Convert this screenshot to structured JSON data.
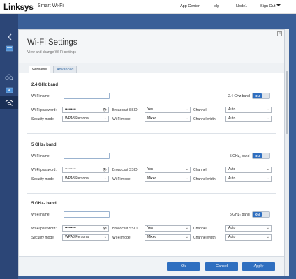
{
  "app": {
    "logo": "Linksys",
    "product": "Smart Wi-Fi",
    "nav": [
      "App Center",
      "Help",
      "Node1",
      "Sign Out"
    ]
  },
  "sidebar": {
    "back_icon": "chevron-left-icon",
    "items": [
      "device-list-icon",
      "connectivity-icon",
      "network-map-icon",
      "wifi-settings-icon"
    ]
  },
  "modal": {
    "title": "Wi-Fi Settings",
    "subtitle": "View and change Wi-Fi settings",
    "close_label": "x",
    "tabs": [
      "Wireless",
      "Advanced"
    ]
  },
  "labels": {
    "wifi_name": "Wi-Fi name:",
    "wifi_password": "Wi-Fi password:",
    "security_mode": "Security mode:",
    "broadcast_ssid": "Broadcast SSID:",
    "wifi_mode": "Wi-Fi mode:",
    "channel": "Channel:",
    "channel_width": "Channel width:"
  },
  "bands": [
    {
      "title": "2.4 GHz band",
      "toggle_label": "2.4 GHz band",
      "toggle_state": "ON",
      "wifi_name": "",
      "password": "•••••••••",
      "security_mode": "WPA3 Personal",
      "broadcast_ssid": "Yes",
      "wifi_mode": "Mixed",
      "channel": "Auto",
      "channel_width": "Auto"
    },
    {
      "title": "5 GHz₁ band",
      "toggle_label": "5 GHz₁ band",
      "toggle_state": "ON",
      "wifi_name": "",
      "password": "•••••••••",
      "security_mode": "WPA3 Personal",
      "broadcast_ssid": "Yes",
      "wifi_mode": "Mixed",
      "channel": "Auto",
      "channel_width": "Auto"
    },
    {
      "title": "5 GHz₂ band",
      "toggle_label": "5 GHz₂ band",
      "toggle_state": "ON",
      "wifi_name": "",
      "password": "•••••••••",
      "security_mode": "WPA3 Personal",
      "broadcast_ssid": "Yes",
      "wifi_mode": "Mixed",
      "channel": "Auto",
      "channel_width": "Auto"
    }
  ],
  "footer": {
    "ok": "Ok",
    "cancel": "Cancel",
    "apply": "Apply"
  },
  "colors": {
    "accent": "#2f6fc0",
    "sidebar": "#2c4677",
    "background": "#3a5f98"
  }
}
